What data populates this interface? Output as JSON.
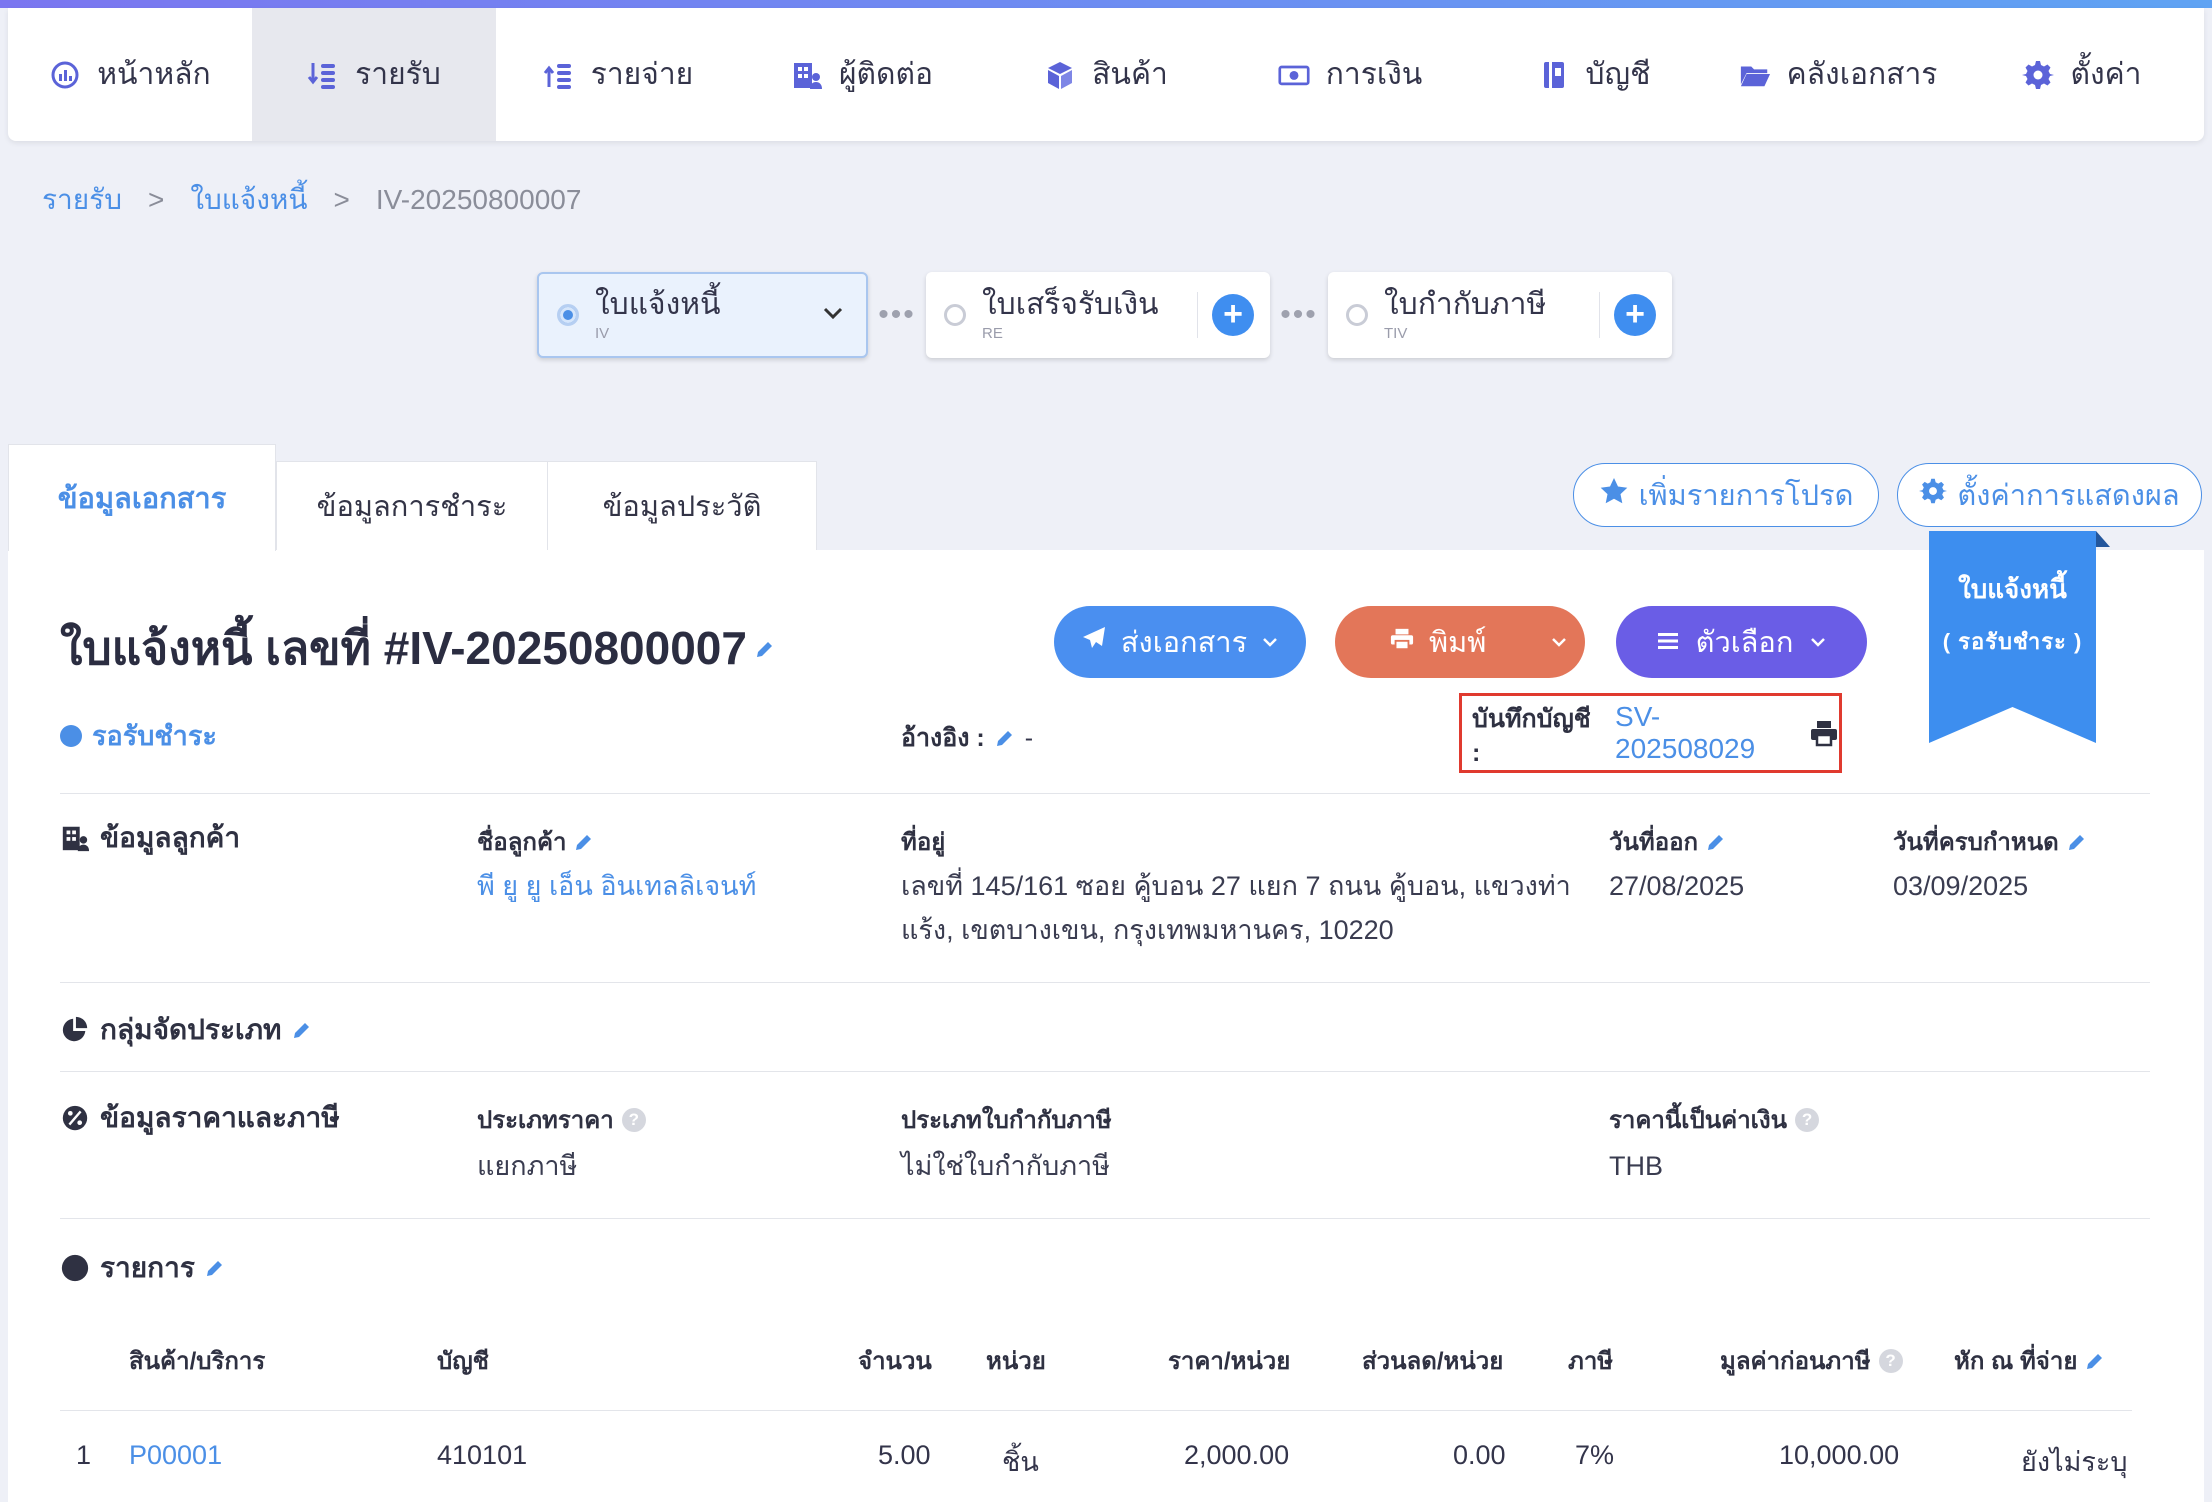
{
  "nav": [
    {
      "label": "หน้าหลัก",
      "icon": "dashboard-icon"
    },
    {
      "label": "รายรับ",
      "icon": "income-icon"
    },
    {
      "label": "รายจ่าย",
      "icon": "expense-icon"
    },
    {
      "label": "ผู้ติดต่อ",
      "icon": "contacts-icon"
    },
    {
      "label": "สินค้า",
      "icon": "product-box-icon"
    },
    {
      "label": "การเงิน",
      "icon": "money-icon"
    },
    {
      "label": "บัญชี",
      "icon": "ledger-book-icon"
    },
    {
      "label": "คลังเอกสาร",
      "icon": "folder-icon"
    },
    {
      "label": "ตั้งค่า",
      "icon": "gear-icon"
    }
  ],
  "nav_active": 1,
  "breadcrumb": {
    "root": "รายรับ",
    "sep": ">",
    "section": "ใบแจ้งหนี้",
    "current": "IV-20250800007"
  },
  "flow": [
    {
      "label": "ใบแจ้งหนี้",
      "code": "IV",
      "active": true
    },
    {
      "label": "ใบเสร็จรับเงิน",
      "code": "RE",
      "active": false
    },
    {
      "label": "ใบกำกับภาษี",
      "code": "TIV",
      "active": false
    }
  ],
  "flow_dots": "•••",
  "tabs": [
    "ข้อมูลเอกสาร",
    "ข้อมูลการชำระ",
    "ข้อมูลประวัติ"
  ],
  "top_buttons": {
    "favorite": "เพิ่มรายการโปรด",
    "display_settings": "ตั้งค่าการแสดงผล"
  },
  "ribbon": {
    "line1": "ใบแจ้งหนี้",
    "line2": "( รอรับชำระ )"
  },
  "doc": {
    "title": "ใบแจ้งหนี้ เลขที่ #IV-20250800007",
    "status": "รอรับชำระ",
    "ref_label": "อ้างอิง :",
    "ref_value": "-",
    "account_label": "บันทึกบัญชี :",
    "account_value": "SV-202508029"
  },
  "actions": {
    "send": "ส่งเอกสาร",
    "print": "พิมพ์",
    "options": "ตัวเลือก"
  },
  "colors": {
    "primary": "#4a8ff0",
    "print": "#e37659",
    "options": "#6a5de6",
    "highlight": "#e03a2f"
  },
  "customer": {
    "section": "ข้อมูลลูกค้า",
    "name_label": "ชื่อลูกค้า",
    "name": "พี ยู ยู เอ็น อินเทลลิเจนท์",
    "address_label": "ที่อยู่",
    "address_line1": "เลขที่ 145/161 ซอย คู้บอน 27 แยก 7 ถนน คู้บอน, แขวงท่า",
    "address_line2": "แร้ง, เขตบางเขน, กรุงเทพมหานคร, 10220",
    "issue_label": "วันที่ออก",
    "issue_date": "27/08/2025",
    "due_label": "วันที่ครบกำหนด",
    "due_date": "03/09/2025"
  },
  "category": {
    "section": "กลุ่มจัดประเภท"
  },
  "pricing": {
    "section": "ข้อมูลราคาและภาษี",
    "price_type_label": "ประเภทราคา",
    "price_type": "แยกภาษี",
    "tax_invoice_label": "ประเภทใบกำกับภาษี",
    "tax_invoice": "ไม่ใช่ใบกำกับภาษี",
    "currency_label": "ราคานี้เป็นค่าเงิน",
    "currency": "THB"
  },
  "items": {
    "section": "รายการ",
    "headers": [
      "สินค้า/บริการ",
      "บัญชี",
      "จำนวน",
      "หน่วย",
      "ราคา/หน่วย",
      "ส่วนลด/หน่วย",
      "ภาษี",
      "มูลค่าก่อนภาษี",
      "หัก ณ ที่จ่าย"
    ],
    "rows": [
      {
        "no": "1",
        "product": "P00001",
        "account": "410101",
        "qty": "5.00",
        "unit": "ชิ้น",
        "price": "2,000.00",
        "discount": "0.00",
        "tax": "7%",
        "pretax": "10,000.00",
        "wht": "ยังไม่ระบุ"
      }
    ]
  }
}
